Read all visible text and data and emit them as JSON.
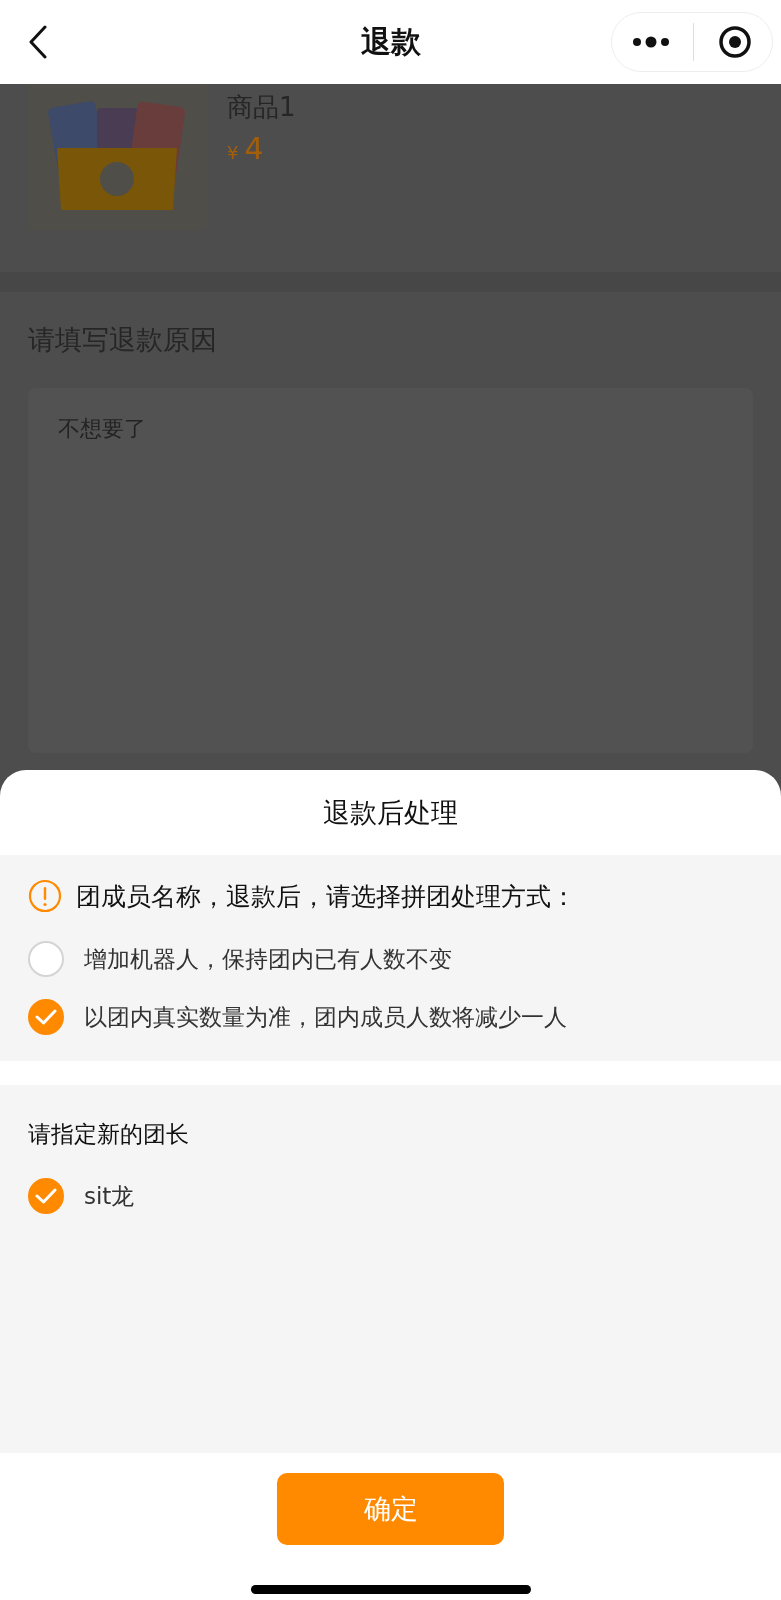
{
  "nav": {
    "title": "退款"
  },
  "product": {
    "name": "商品1",
    "currency": "¥",
    "price": "4"
  },
  "reason": {
    "label": "请填写退款原因",
    "value": "不想要了"
  },
  "sheet": {
    "title": "退款后处理",
    "notice": "团成员名称，退款后，请选择拼团处理方式：",
    "options": [
      {
        "label": "增加机器人，保持团内已有人数不变",
        "selected": false
      },
      {
        "label": "以团内真实数量为准，团内成员人数将减少一人",
        "selected": true
      }
    ],
    "leader_label": "请指定新的团长",
    "leaders": [
      {
        "name": "sit龙",
        "selected": true
      }
    ]
  },
  "confirm_button": "确定"
}
